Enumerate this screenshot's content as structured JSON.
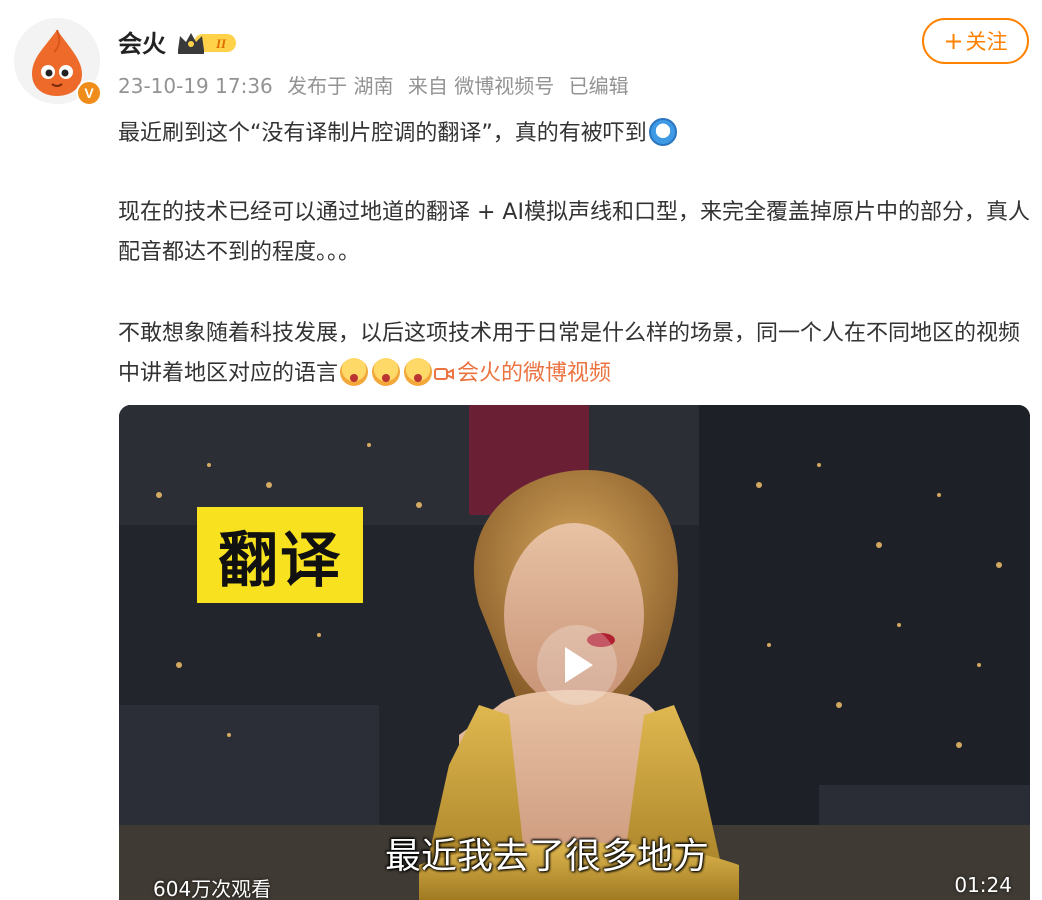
{
  "post": {
    "author": "会火",
    "level_badge": "II",
    "verified_badge": "V",
    "meta": {
      "time": "23-10-19 17:36",
      "location": "发布于 湖南",
      "source": "来自 微博视频号",
      "edited": "已编辑"
    },
    "follow_label": "关注",
    "follow_plus": "+",
    "text": {
      "p1": "最近刷到这个“没有译制片腔调的翻译”，真的有被吓到",
      "p2": "现在的技术已经可以通过地道的翻译 + AI模拟声线和口型，来完全覆盖掉原片中的部分，真人配音都达不到的程度。。。",
      "p3": "不敢想象随着科技发展，以后这项技术用于日常是什么样的场景，同一个人在不同地区的视频中讲着地区对应的语言",
      "video_link": "会火的微博视频"
    }
  },
  "video": {
    "overlay_label": "翻译",
    "subtitle": "最近我去了很多地方",
    "views": "604万次观看",
    "duration": "01:24"
  },
  "icons": {
    "emoji_p1": "dizzy-emoji-icon",
    "emoji_p3": "shocked-emoji-icon",
    "video_link": "video-camera-icon",
    "play": "play-icon"
  },
  "colors": {
    "accent": "#ff8200",
    "link": "#eb7340",
    "meta": "#939393",
    "overlay_label_bg": "#f8e21f"
  }
}
